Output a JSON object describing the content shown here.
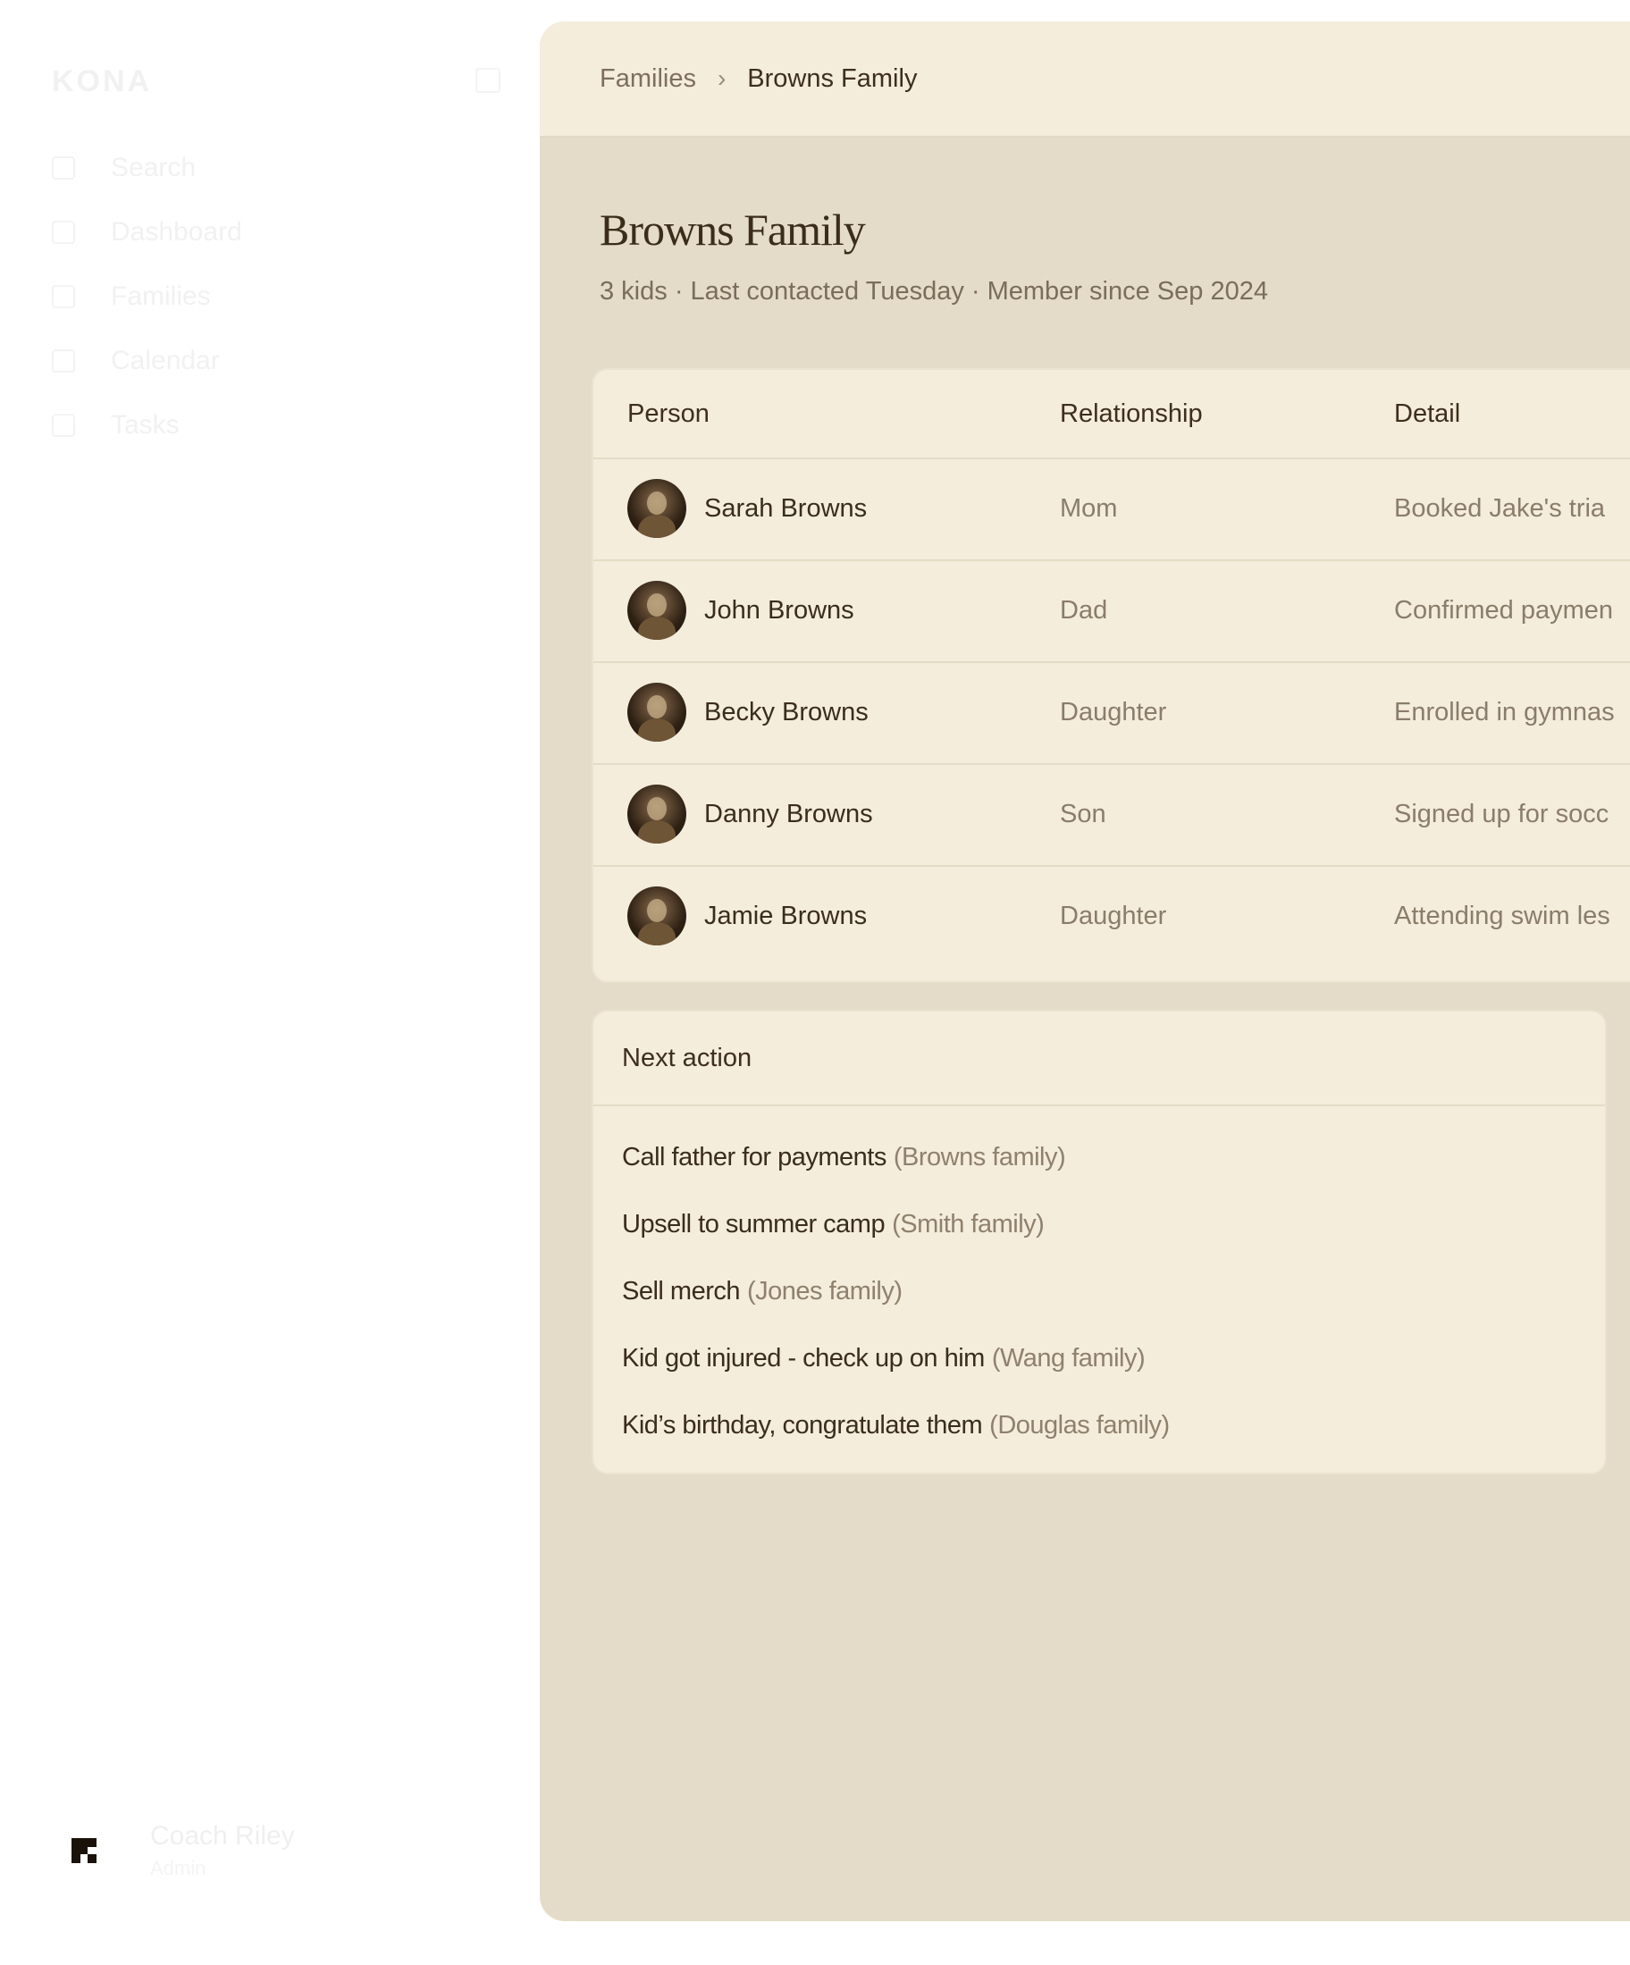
{
  "sidebar": {
    "brand": "KONA",
    "nav": [
      {
        "icon": "search-icon",
        "label": "Search"
      },
      {
        "icon": "dashboard-icon",
        "label": "Dashboard"
      },
      {
        "icon": "families-icon",
        "label": "Families"
      },
      {
        "icon": "calendar-icon",
        "label": "Calendar"
      },
      {
        "icon": "tasks-icon",
        "label": "Tasks"
      }
    ],
    "user": {
      "name": "Coach Riley",
      "role": "Admin"
    }
  },
  "breadcrumb": {
    "parent": "Families",
    "current": "Browns Family"
  },
  "page": {
    "title": "Browns Family",
    "subtitle": "3 kids · Last contacted Tuesday · Member since Sep 2024"
  },
  "table": {
    "headers": {
      "person": "Person",
      "relationship": "Relationship",
      "detail": "Detail"
    },
    "rows": [
      {
        "name": "Sarah Browns",
        "relationship": "Mom",
        "detail": "Booked Jake's tria"
      },
      {
        "name": "John Browns",
        "relationship": "Dad",
        "detail": "Confirmed paymen"
      },
      {
        "name": "Becky Browns",
        "relationship": "Daughter",
        "detail": "Enrolled in gymnas"
      },
      {
        "name": "Danny Browns",
        "relationship": "Son",
        "detail": "Signed up for socc"
      },
      {
        "name": "Jamie Browns",
        "relationship": "Daughter",
        "detail": "Attending swim les"
      }
    ]
  },
  "next_action": {
    "title": "Next action",
    "items": [
      {
        "task": "Call father for payments",
        "family": "(Browns family)"
      },
      {
        "task": "Upsell to summer camp",
        "family": "(Smith family)"
      },
      {
        "task": "Sell merch",
        "family": "(Jones family)"
      },
      {
        "task": "Kid got injured - check up on him",
        "family": "(Wang family)"
      },
      {
        "task": "Kid’s birthday, congratulate them",
        "family": "(Douglas family)"
      }
    ]
  }
}
